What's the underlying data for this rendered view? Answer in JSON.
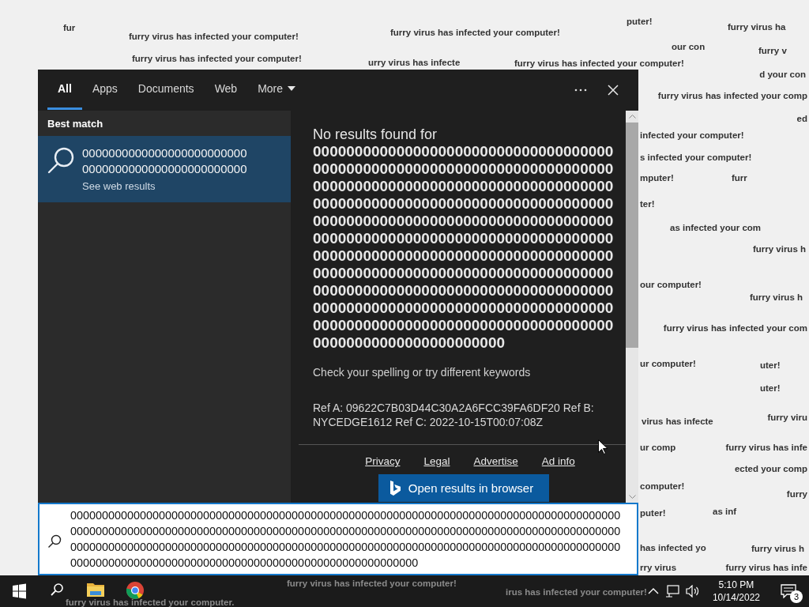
{
  "background_texts": [
    "fur",
    "furry virus has infected your computer!",
    "furry virus has infected your computer!",
    "puter!",
    "furry virus ha",
    "our con",
    "furry v",
    "furry virus has infected your computer!",
    "urry virus has infecte",
    "furry virus has infected your computer!",
    "d your con",
    "furry virus has infected your comp",
    "ed",
    "infected your computer!",
    "s infected your computer!",
    "mputer!",
    "furr",
    "ter!",
    "as infected your com",
    "furry virus h",
    "our computer!",
    "furry virus h",
    "furry virus has infected your com",
    "ur computer!",
    "uter!",
    "uter!",
    "virus has infecte",
    "furry viru",
    "ur comp",
    "furry virus has infe",
    "ected your comp",
    "computer!",
    "furry",
    "puter!",
    "as inf",
    "has infected yo",
    "furry virus h",
    "rry virus",
    "furry virus has infe"
  ],
  "search_panel": {
    "tabs": [
      {
        "label": "All",
        "selected": true
      },
      {
        "label": "Apps",
        "selected": false
      },
      {
        "label": "Documents",
        "selected": false
      },
      {
        "label": "Web",
        "selected": false
      },
      {
        "label": "More",
        "selected": false,
        "kind": "dropdown"
      }
    ],
    "best_match": {
      "heading": "Best match",
      "item": {
        "title_lines": [
          "0000000000000000000000000",
          "0000000000000000000000000"
        ],
        "subtitle": "See web results",
        "selected": true
      }
    },
    "results": {
      "heading": "No results found for",
      "query": "00000000000000000000000000000000000000000000000000000000000000000000000000000000000000000000000000000000000000000000000000000000000000000000000000000000000000000000000000000000000000000000000000000000000000000000000000000000000000000000000000000000000000000000000000000000000000000000000000000000000000000000000000000000000000000000000000000000000000000000000000000000000000000000000000000000000000000000000000000000000",
      "hint": "Check your spelling or try different keywords",
      "reference": "Ref A: 09622C7B03D44C30A2A6FCC39FA6DF20 Ref B: NYCEDGE1612 Ref C: 2022-10-15T00:07:08Z",
      "links": [
        "Privacy",
        "Legal",
        "Advertise",
        "Ad info"
      ],
      "button": "Open results in browser"
    },
    "search_box": {
      "value": "0000000000000000000000000000000000000000000000000000000000000000000000000000000000000000000000000000000000000000000000000000000000000000000000000000000000000000000000000000000000000000000000000000000000000000000000000000000000000000000000000000000000000000000000000000000000000000000000000000000000000000000000000000"
    }
  },
  "taskbar": {
    "overlay_texts": [
      "furry virus has infected your computer!",
      "irus has infected your computer!",
      "furry virus has infected your computer."
    ],
    "clock": {
      "time": "5:10 PM",
      "date": "10/14/2022"
    },
    "notification_count": "3"
  }
}
